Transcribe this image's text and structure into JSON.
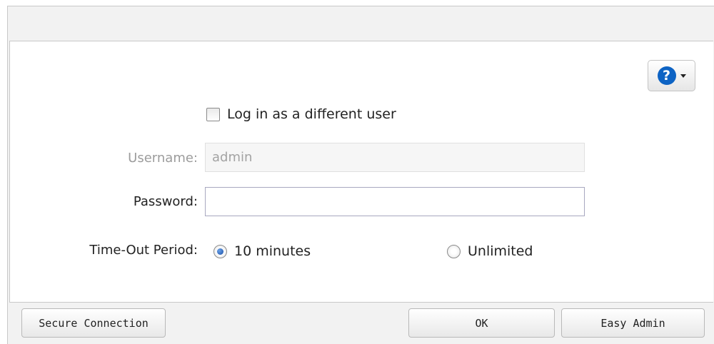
{
  "help": {
    "icon": "question-circle-icon",
    "dropdown_icon": "caret-down-icon",
    "accent": "#0d63c4"
  },
  "form": {
    "different_user_label": "Log in as a different user",
    "different_user_checked": false,
    "username_label": "Username:",
    "username_value": "admin",
    "username_disabled": true,
    "password_label": "Password:",
    "password_value": "",
    "timeout_label": "Time-Out Period:",
    "timeout_options": [
      {
        "label": "10 minutes",
        "checked": true
      },
      {
        "label": "Unlimited",
        "checked": false
      }
    ]
  },
  "footer": {
    "secure_connection_label": "Secure Connection",
    "ok_label": "OK",
    "easy_admin_label": "Easy Admin"
  }
}
